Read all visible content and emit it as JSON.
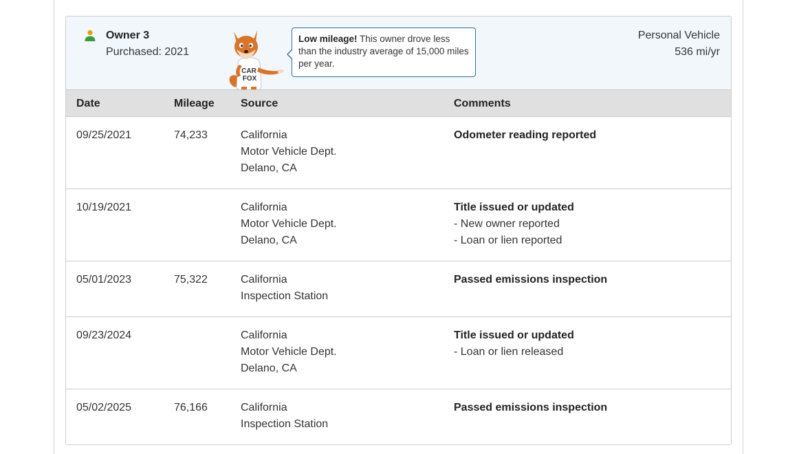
{
  "owner": {
    "name": "Owner 3",
    "purchased": "Purchased: 2021",
    "vehicle_type": "Personal Vehicle",
    "mileage_rate": "536 mi/yr",
    "mascot_shirt_text": [
      "CAR",
      "FOX"
    ]
  },
  "tooltip": {
    "bold": "Low mileage!",
    "text": " This owner drove less than the industry average of 15,000 miles per year."
  },
  "table": {
    "headers": {
      "date": "Date",
      "mileage": "Mileage",
      "source": "Source",
      "comments": "Comments"
    },
    "rows": [
      {
        "date": "09/25/2021",
        "mileage": "74,233",
        "source": [
          "California",
          "Motor Vehicle Dept.",
          "Delano, CA"
        ],
        "comment_title": "Odometer reading reported",
        "comment_details": []
      },
      {
        "date": "10/19/2021",
        "mileage": "",
        "source": [
          "California",
          "Motor Vehicle Dept.",
          "Delano, CA"
        ],
        "comment_title": "Title issued or updated",
        "comment_details": [
          "- New owner reported",
          "- Loan or lien reported"
        ]
      },
      {
        "date": "05/01/2023",
        "mileage": "75,322",
        "source": [
          "California",
          "Inspection Station"
        ],
        "comment_title": "Passed emissions inspection",
        "comment_details": []
      },
      {
        "date": "09/23/2024",
        "mileage": "",
        "source": [
          "California",
          "Motor Vehicle Dept.",
          "Delano, CA"
        ],
        "comment_title": "Title issued or updated",
        "comment_details": [
          "- Loan or lien released"
        ]
      },
      {
        "date": "05/02/2025",
        "mileage": "76,166",
        "source": [
          "California",
          "Inspection Station"
        ],
        "comment_title": "Passed emissions inspection",
        "comment_details": []
      }
    ]
  },
  "colors": {
    "header_bg": "#f2f7fc",
    "table_head_bg": "#e0e0e0",
    "tooltip_border": "#2f6fa7",
    "owner_icon_green": "#3f9b3a",
    "owner_icon_head": "#d9a400",
    "fox_orange": "#d9742b"
  }
}
